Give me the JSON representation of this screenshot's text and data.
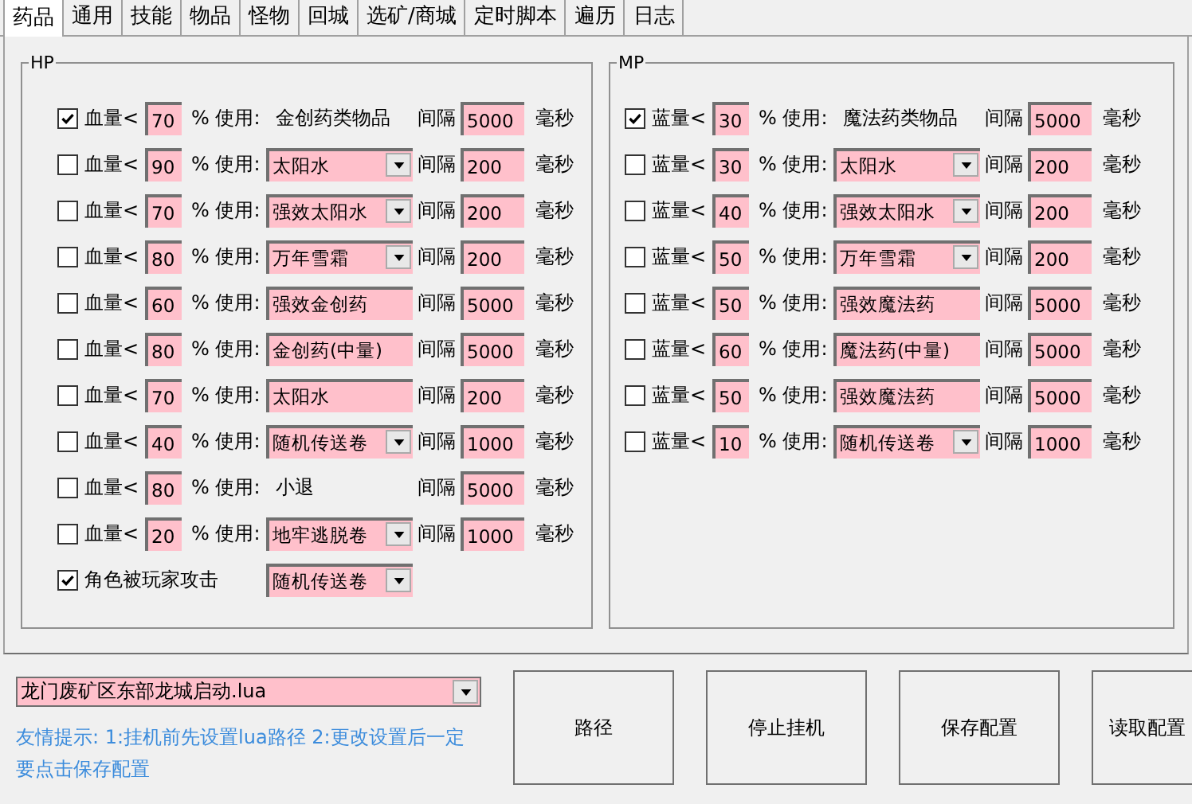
{
  "tabs": [
    {
      "label": "药品",
      "selected": true
    },
    {
      "label": "通用",
      "selected": false
    },
    {
      "label": "技能",
      "selected": false
    },
    {
      "label": "物品",
      "selected": false
    },
    {
      "label": "怪物",
      "selected": false
    },
    {
      "label": "回城",
      "selected": false
    },
    {
      "label": "选矿/商城",
      "selected": false
    },
    {
      "label": "定时脚本",
      "selected": false
    },
    {
      "label": "遍历",
      "selected": false
    },
    {
      "label": "日志",
      "selected": false
    }
  ],
  "groups": [
    {
      "title": "HP",
      "rows": [
        {
          "checked": true,
          "label": "血量<",
          "threshold": "70",
          "use_label": "% 使用:",
          "kind": "static",
          "item": "金创药类物品",
          "interval_label": "间隔",
          "interval": "5000",
          "unit": "毫秒"
        },
        {
          "checked": false,
          "label": "血量<",
          "threshold": "90",
          "use_label": "% 使用:",
          "kind": "combo",
          "item": "太阳水",
          "interval_label": "间隔",
          "interval": "200",
          "unit": "毫秒"
        },
        {
          "checked": false,
          "label": "血量<",
          "threshold": "70",
          "use_label": "% 使用:",
          "kind": "combo",
          "item": "强效太阳水",
          "interval_label": "间隔",
          "interval": "200",
          "unit": "毫秒"
        },
        {
          "checked": false,
          "label": "血量<",
          "threshold": "80",
          "use_label": "% 使用:",
          "kind": "combo",
          "item": "万年雪霜",
          "interval_label": "间隔",
          "interval": "200",
          "unit": "毫秒"
        },
        {
          "checked": false,
          "label": "血量<",
          "threshold": "60",
          "use_label": "% 使用:",
          "kind": "field",
          "item": "强效金创药",
          "interval_label": "间隔",
          "interval": "5000",
          "unit": "毫秒"
        },
        {
          "checked": false,
          "label": "血量<",
          "threshold": "80",
          "use_label": "% 使用:",
          "kind": "field",
          "item": "金创药(中量)",
          "interval_label": "间隔",
          "interval": "5000",
          "unit": "毫秒"
        },
        {
          "checked": false,
          "label": "血量<",
          "threshold": "70",
          "use_label": "% 使用:",
          "kind": "field",
          "item": "太阳水",
          "interval_label": "间隔",
          "interval": "200",
          "unit": "毫秒"
        },
        {
          "checked": false,
          "label": "血量<",
          "threshold": "40",
          "use_label": "% 使用:",
          "kind": "combo",
          "item": "随机传送卷",
          "interval_label": "间隔",
          "interval": "1000",
          "unit": "毫秒"
        },
        {
          "checked": false,
          "label": "血量<",
          "threshold": "80",
          "use_label": "% 使用:",
          "kind": "static",
          "item": "小退",
          "interval_label": "间隔",
          "interval": "5000",
          "unit": "毫秒"
        },
        {
          "checked": false,
          "label": "血量<",
          "threshold": "20",
          "use_label": "% 使用:",
          "kind": "combo",
          "item": "地牢逃脱卷",
          "interval_label": "间隔",
          "interval": "1000",
          "unit": "毫秒"
        }
      ],
      "extra": {
        "checked": true,
        "label": "角色被玩家攻击",
        "item": "随机传送卷"
      }
    },
    {
      "title": "MP",
      "rows": [
        {
          "checked": true,
          "label": "蓝量<",
          "threshold": "30",
          "use_label": "% 使用:",
          "kind": "static",
          "item": "魔法药类物品",
          "interval_label": "间隔",
          "interval": "5000",
          "unit": "毫秒"
        },
        {
          "checked": false,
          "label": "蓝量<",
          "threshold": "30",
          "use_label": "% 使用:",
          "kind": "combo",
          "item": "太阳水",
          "interval_label": "间隔",
          "interval": "200",
          "unit": "毫秒"
        },
        {
          "checked": false,
          "label": "蓝量<",
          "threshold": "40",
          "use_label": "% 使用:",
          "kind": "combo",
          "item": "强效太阳水",
          "interval_label": "间隔",
          "interval": "200",
          "unit": "毫秒"
        },
        {
          "checked": false,
          "label": "蓝量<",
          "threshold": "50",
          "use_label": "% 使用:",
          "kind": "combo",
          "item": "万年雪霜",
          "interval_label": "间隔",
          "interval": "200",
          "unit": "毫秒"
        },
        {
          "checked": false,
          "label": "蓝量<",
          "threshold": "50",
          "use_label": "% 使用:",
          "kind": "field",
          "item": "强效魔法药",
          "interval_label": "间隔",
          "interval": "5000",
          "unit": "毫秒"
        },
        {
          "checked": false,
          "label": "蓝量<",
          "threshold": "60",
          "use_label": "% 使用:",
          "kind": "field",
          "item": "魔法药(中量)",
          "interval_label": "间隔",
          "interval": "5000",
          "unit": "毫秒"
        },
        {
          "checked": false,
          "label": "蓝量<",
          "threshold": "50",
          "use_label": "% 使用:",
          "kind": "field",
          "item": "强效魔法药",
          "interval_label": "间隔",
          "interval": "5000",
          "unit": "毫秒"
        },
        {
          "checked": false,
          "label": "蓝量<",
          "threshold": "10",
          "use_label": "% 使用:",
          "kind": "combo",
          "item": "随机传送卷",
          "interval_label": "间隔",
          "interval": "1000",
          "unit": "毫秒"
        }
      ]
    }
  ],
  "script_path": "龙门废矿区东部龙城启动.lua",
  "hint": "友情提示: 1:挂机前先设置lua路径 2:更改设置后一定要点击保存配置",
  "buttons": [
    "路径",
    "停止挂机",
    "保存配置",
    "读取配置"
  ]
}
